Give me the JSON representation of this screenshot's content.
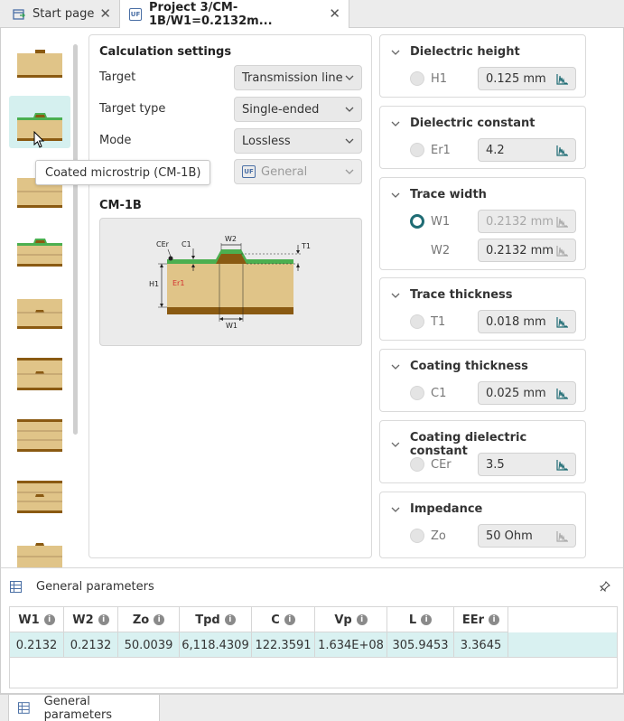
{
  "tabs": [
    {
      "label": "Start page",
      "icon": "start-page-icon"
    },
    {
      "label": "Project 3/CM-1B/W1=0.2132m...",
      "badge": "UF"
    }
  ],
  "tooltip": "Coated microstrip (CM-1B)",
  "calc": {
    "title": "Calculation settings",
    "rows": [
      {
        "label": "Target",
        "value": "Transmission line"
      },
      {
        "label": "Target type",
        "value": "Single-ended"
      },
      {
        "label": "Mode",
        "value": "Lossless"
      },
      {
        "label": "",
        "value": "General",
        "badge": "UF"
      }
    ],
    "structure_label": "CM-1B",
    "diagram_labels": {
      "cer": "CEr",
      "c1": "C1",
      "w2": "W2",
      "t1": "T1",
      "h1": "H1",
      "er1": "Er1",
      "w1": "W1"
    }
  },
  "groups": [
    {
      "title": "Dielectric height",
      "params": [
        {
          "name": "H1",
          "value": "0.125 mm",
          "selected": false
        }
      ]
    },
    {
      "title": "Dielectric constant",
      "params": [
        {
          "name": "Er1",
          "value": "4.2",
          "selected": false
        }
      ]
    },
    {
      "title": "Trace width",
      "params": [
        {
          "name": "W1",
          "value": "0.2132 mm",
          "selected": true
        },
        {
          "name": "W2",
          "value": "0.2132 mm",
          "selected": false
        }
      ]
    },
    {
      "title": "Trace thickness",
      "params": [
        {
          "name": "T1",
          "value": "0.018 mm",
          "selected": false
        }
      ]
    },
    {
      "title": "Coating thickness",
      "params": [
        {
          "name": "C1",
          "value": "0.025 mm",
          "selected": false
        }
      ]
    },
    {
      "title": "Coating dielectric constant",
      "params": [
        {
          "name": "CEr",
          "value": "3.5",
          "selected": false
        }
      ]
    },
    {
      "title": "Impedance",
      "params": [
        {
          "name": "Zo",
          "value": "50 Ohm",
          "selected": false
        }
      ]
    }
  ],
  "bottom": {
    "title": "General parameters",
    "columns": [
      "W1",
      "W2",
      "Zo",
      "Tpd",
      "C",
      "Vp",
      "L",
      "EEr"
    ],
    "row": [
      "0.2132",
      "0.2132",
      "50.0039",
      "6,118.4309",
      "122.3591",
      "1.634E+08",
      "305.9453",
      "3.3645"
    ],
    "tab_label": "General parameters"
  },
  "colors": {
    "accent": "#1f6c74",
    "selected_row": "#d9f1f1",
    "selected_thumb": "#d5f0ef",
    "copper": "#8a5a12",
    "dielectric": "#e0c488",
    "coating": "#4caf50"
  }
}
